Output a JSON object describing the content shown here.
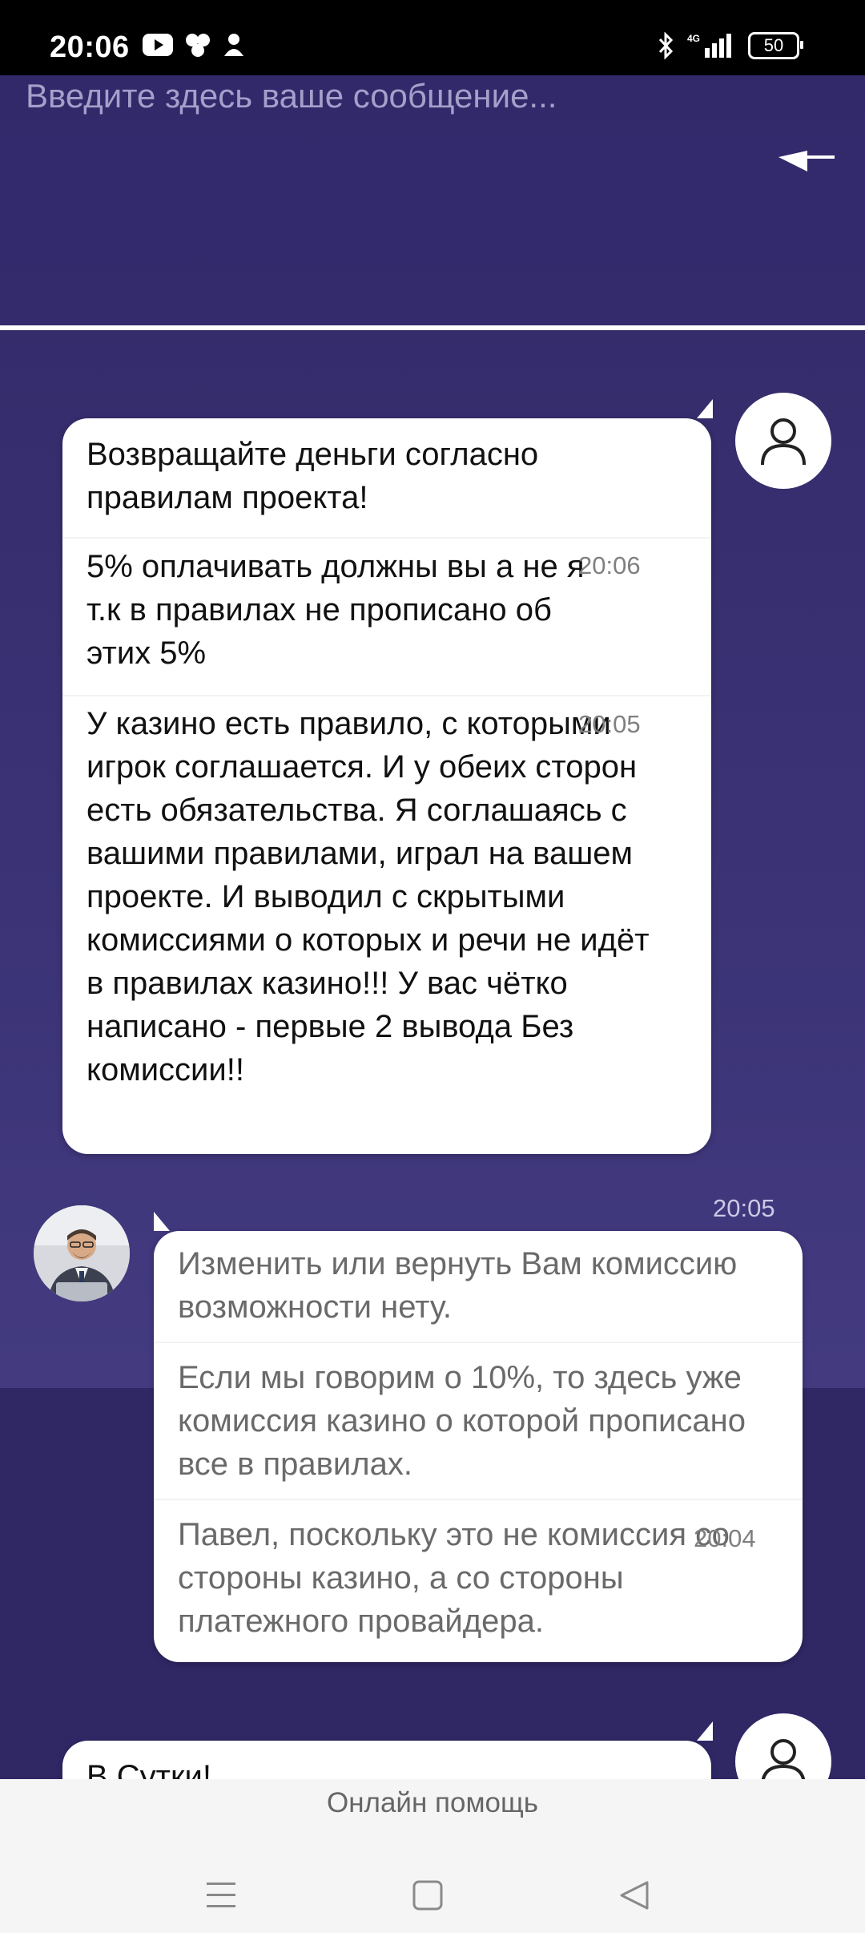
{
  "status_bar": {
    "time": "20:06",
    "battery": "50",
    "network": "4G"
  },
  "composer": {
    "placeholder": "Введите здесь ваше сообщение..."
  },
  "messages": [
    {
      "author": "user",
      "parts": [
        {
          "text": "Возвращайте деньги согласно правилам проекта!",
          "time": ""
        },
        {
          "text": "5% оплачивать должны вы а не я т.к в правилах не прописано об этих 5%",
          "time": "20:06"
        },
        {
          "text": "У казино есть правило, с которыми игрок соглашается. И у обеих сторон есть обязательства. Я соглашаясь с вашими правилами, играл на вашем проекте. И выводил с скрытыми комиссиями о которых и речи не идёт  в правилах казино!!! У вас чётко написано - первые 2 вывода Без комиссии!!",
          "time": "20:05"
        }
      ]
    },
    {
      "author": "operator",
      "header_time": "20:05",
      "parts": [
        {
          "text": "Изменить или вернуть Вам комиссию возможности нету.",
          "time": ""
        },
        {
          "text": "Если мы говорим о 10%, то здесь уже комиссия казино о которой прописано все в правилах.",
          "time": ""
        },
        {
          "text": "Павел, поскольку это не комиссия со стороны казино, а со стороны платежного провайдера.",
          "time": "20:04"
        }
      ]
    },
    {
      "author": "user",
      "parts": [
        {
          "text": "В Сутки!",
          "time": ""
        }
      ]
    }
  ],
  "footer": {
    "title": "Онлайн помощь"
  }
}
